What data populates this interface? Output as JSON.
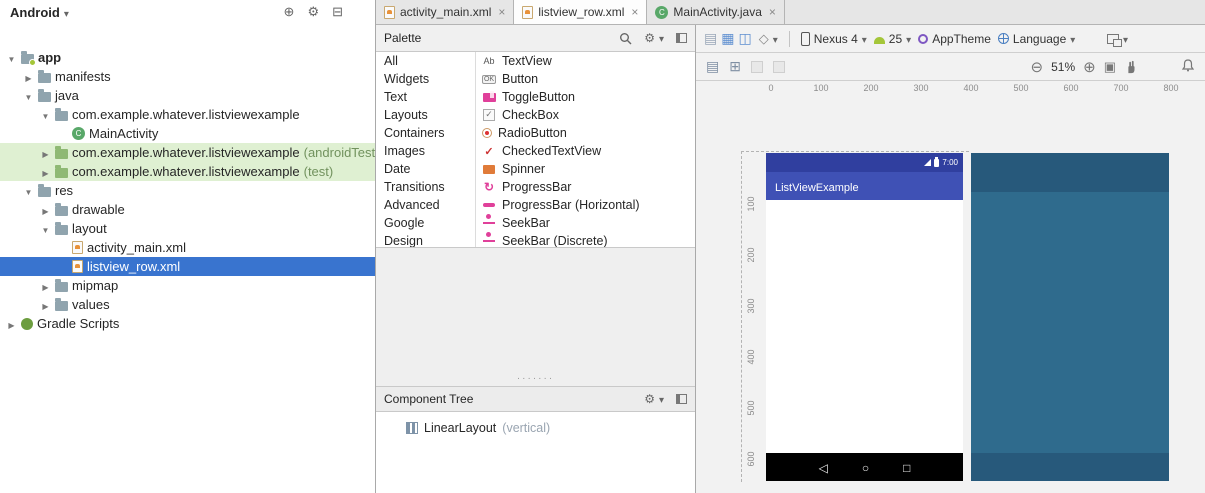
{
  "colors": {
    "selection_blue": "#3974cf",
    "test_row_green": "#dff0d2",
    "appbar_blue": "#3f51b5",
    "statusbar_blue": "#303f9f",
    "blueprint_dark": "#27597b",
    "blueprint_mid": "#2f6b8d"
  },
  "project_panel": {
    "view_selector": "Android",
    "tree": [
      {
        "label": "app",
        "level": 0,
        "state": "expanded",
        "icon": "app-folder"
      },
      {
        "label": "manifests",
        "level": 1,
        "state": "collapsed",
        "icon": "folder"
      },
      {
        "label": "java",
        "level": 1,
        "state": "expanded",
        "icon": "folder"
      },
      {
        "label": "com.example.whatever.listviewexample",
        "level": 2,
        "state": "expanded",
        "icon": "package"
      },
      {
        "label": "MainActivity",
        "level": 3,
        "icon": "class"
      },
      {
        "label": "com.example.whatever.listviewexample",
        "suffix": "(androidTest)",
        "level": 2,
        "state": "collapsed",
        "icon": "package-test",
        "highlight": "green"
      },
      {
        "label": "com.example.whatever.listviewexample",
        "suffix": "(test)",
        "level": 2,
        "state": "collapsed",
        "icon": "package-test",
        "highlight": "green"
      },
      {
        "label": "res",
        "level": 1,
        "state": "expanded",
        "icon": "folder"
      },
      {
        "label": "drawable",
        "level": 2,
        "state": "collapsed",
        "icon": "folder"
      },
      {
        "label": "layout",
        "level": 2,
        "state": "expanded",
        "icon": "folder"
      },
      {
        "label": "activity_main.xml",
        "level": 3,
        "icon": "xml-file"
      },
      {
        "label": "listview_row.xml",
        "level": 3,
        "icon": "xml-file",
        "selected": true
      },
      {
        "label": "mipmap",
        "level": 2,
        "state": "collapsed",
        "icon": "folder"
      },
      {
        "label": "values",
        "level": 2,
        "state": "collapsed",
        "icon": "folder"
      },
      {
        "label": "Gradle Scripts",
        "level": 0,
        "state": "collapsed",
        "icon": "gradle"
      }
    ]
  },
  "tabs": [
    {
      "label": "activity_main.xml",
      "icon": "xml-file",
      "close": "×",
      "active": false
    },
    {
      "label": "listview_row.xml",
      "icon": "xml-file",
      "close": "×",
      "active": true
    },
    {
      "label": "MainActivity.java",
      "icon": "java-class",
      "close": "×",
      "active": false
    }
  ],
  "palette": {
    "title": "Palette",
    "categories": [
      "All",
      "Widgets",
      "Text",
      "Layouts",
      "Containers",
      "Images",
      "Date",
      "Transitions",
      "Advanced",
      "Google",
      "Design"
    ],
    "components": [
      {
        "label": "TextView",
        "icon": "textview"
      },
      {
        "label": "Button",
        "icon": "button"
      },
      {
        "label": "ToggleButton",
        "icon": "togglebutton"
      },
      {
        "label": "CheckBox",
        "icon": "checkbox"
      },
      {
        "label": "RadioButton",
        "icon": "radiobutton"
      },
      {
        "label": "CheckedTextView",
        "icon": "checkedtextview"
      },
      {
        "label": "Spinner",
        "icon": "spinner"
      },
      {
        "label": "ProgressBar",
        "icon": "progressbar"
      },
      {
        "label": "ProgressBar (Horizontal)",
        "icon": "progressbar-horizontal"
      },
      {
        "label": "SeekBar",
        "icon": "seekbar"
      },
      {
        "label": "SeekBar (Discrete)",
        "icon": "seekbar-discrete"
      }
    ]
  },
  "component_tree": {
    "title": "Component Tree",
    "items": [
      {
        "label": "LinearLayout",
        "suffix": "(vertical)"
      }
    ]
  },
  "design_toolbar": {
    "device": "Nexus 4",
    "api_level": "25",
    "theme": "AppTheme",
    "locale": "Language",
    "zoom_level": "51%"
  },
  "canvas": {
    "ruler_h": [
      "0",
      "100",
      "200",
      "300",
      "400",
      "500",
      "600",
      "700",
      "800"
    ],
    "ruler_v": [
      "100",
      "200",
      "300",
      "400",
      "500",
      "600"
    ],
    "device_preview": {
      "app_title": "ListViewExample",
      "status_time": "7:00"
    }
  }
}
